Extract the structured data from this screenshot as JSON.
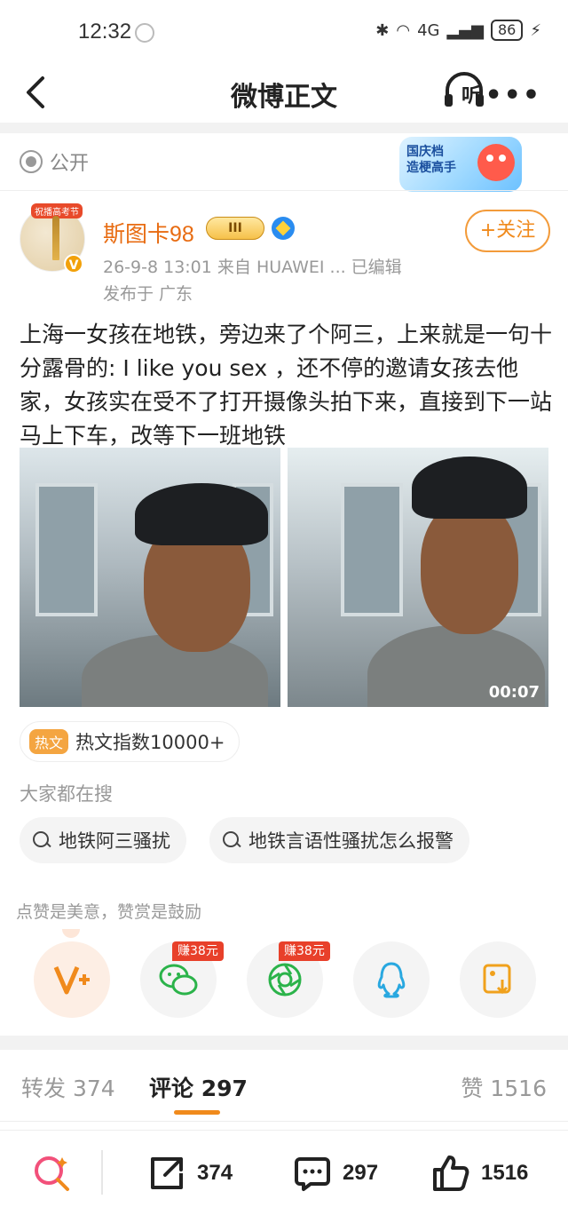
{
  "status_bar": {
    "time": "12:32",
    "network": "4G",
    "battery": "86"
  },
  "header": {
    "title": "微博正文",
    "listen_label": "听",
    "more": "•••"
  },
  "visibility": {
    "label": "公开"
  },
  "promo": {
    "line1": "国庆档",
    "line2": "造梗高手"
  },
  "author": {
    "avatar_ribbon": "祝播高考节",
    "verified_mark": "V",
    "name": "斯图卡98",
    "level_badge": "III",
    "meta": "26-9-8 13:01   来自 HUAWEI ...   已编辑",
    "location": "发布于 广东",
    "follow_label": "+关注"
  },
  "post": {
    "text": "上海一女孩在地铁，旁边来了个阿三，上来就是一句十分露骨的: I like you sex ，还不停的邀请女孩去他家，女孩实在受不了打开摄像头拍下来，直接到下一站马上下车，改等下一班地铁",
    "video_time": "00:07"
  },
  "hot_index": {
    "tag": "热文",
    "text": "热文指数10000+"
  },
  "searching": {
    "title": "大家都在搜",
    "chips": [
      "地铁阿三骚扰",
      "地铁言语性骚扰怎么报警"
    ]
  },
  "reward_note": "点赞是美意，赞赏是鼓励",
  "share": {
    "earn_badges": [
      "赚38元",
      "赚38元"
    ],
    "icons": [
      "reward-v-icon",
      "wechat-icon",
      "moments-icon",
      "qq-icon",
      "save-image-icon"
    ]
  },
  "tabs": {
    "repost": "转发 374",
    "comment": "评论 297",
    "like": "赞 1516"
  },
  "bottom_bar": {
    "repost_count": "374",
    "comment_count": "297",
    "like_count": "1516"
  },
  "colors": {
    "accent": "#f08a1c",
    "username": "#e86c12",
    "badge_red": "#e8402a"
  }
}
